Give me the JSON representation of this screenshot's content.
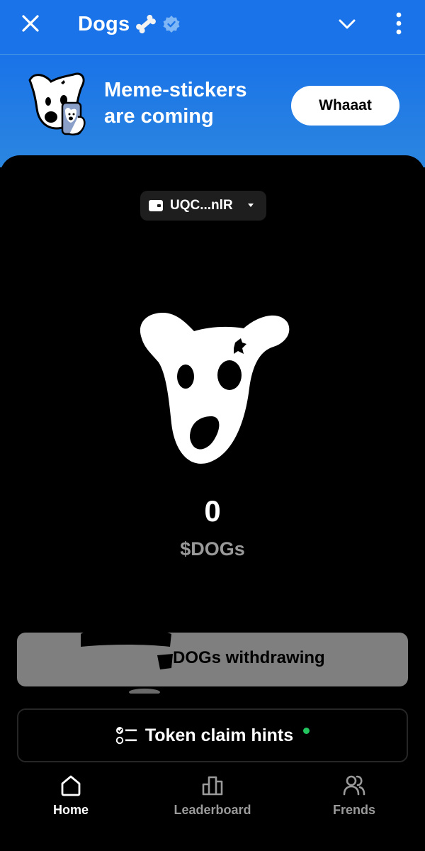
{
  "topbar": {
    "title": "Dogs",
    "icons": [
      "close-icon",
      "bone-icon",
      "verified-badge-icon",
      "chevron-down-icon",
      "more-vertical-icon"
    ]
  },
  "banner": {
    "line1": "Meme-stickers",
    "line2": "are coming",
    "button_label": "Whaaat"
  },
  "wallet": {
    "address": "UQC...nlR",
    "icons": [
      "wallet-icon",
      "caret-down-icon"
    ]
  },
  "balance": {
    "amount": "0",
    "currency": "$DOGs"
  },
  "actions": {
    "withdraw_label": "DOGs withdrawing",
    "hints_label": "Token claim hints"
  },
  "nav": {
    "items": [
      {
        "label": "Home",
        "icon": "home-icon",
        "active": true
      },
      {
        "label": "Leaderboard",
        "icon": "leaderboard-icon",
        "active": false
      },
      {
        "label": "Frends",
        "icon": "friends-icon",
        "active": false
      }
    ]
  },
  "colors": {
    "brand_blue": "#1a73e8",
    "background": "#000000",
    "muted": "#9a9a9a",
    "withdraw_bg": "#7f7f7f",
    "notification_dot": "#22c55e"
  }
}
